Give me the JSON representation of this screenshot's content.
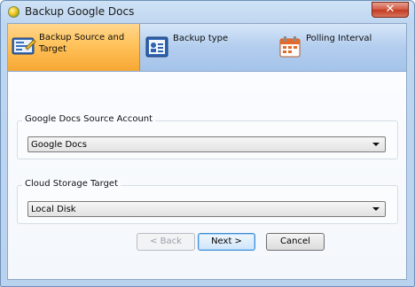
{
  "window": {
    "title": "Backup Google Docs",
    "close_glyph": "✕",
    "icons": {
      "app": "app-icon",
      "close": "close-icon"
    }
  },
  "tabs": [
    {
      "label": "Backup Source and Target",
      "icon": "source-target-icon",
      "active": true
    },
    {
      "label": "Backup type",
      "icon": "backup-type-icon",
      "active": false
    },
    {
      "label": "Polling Interval",
      "icon": "calendar-icon",
      "active": false
    }
  ],
  "source_group": {
    "legend": "Google Docs Source Account",
    "selected": "Google Docs"
  },
  "target_group": {
    "legend": "Cloud Storage Target",
    "selected": "Local Disk"
  },
  "buttons": {
    "back": "< Back",
    "next": "Next >",
    "cancel": "Cancel"
  },
  "colors": {
    "active_tab": "#ffc25a",
    "tab_bar": "#b2cdee",
    "close_button": "#c23a22",
    "frame": "#bfd6f0"
  }
}
